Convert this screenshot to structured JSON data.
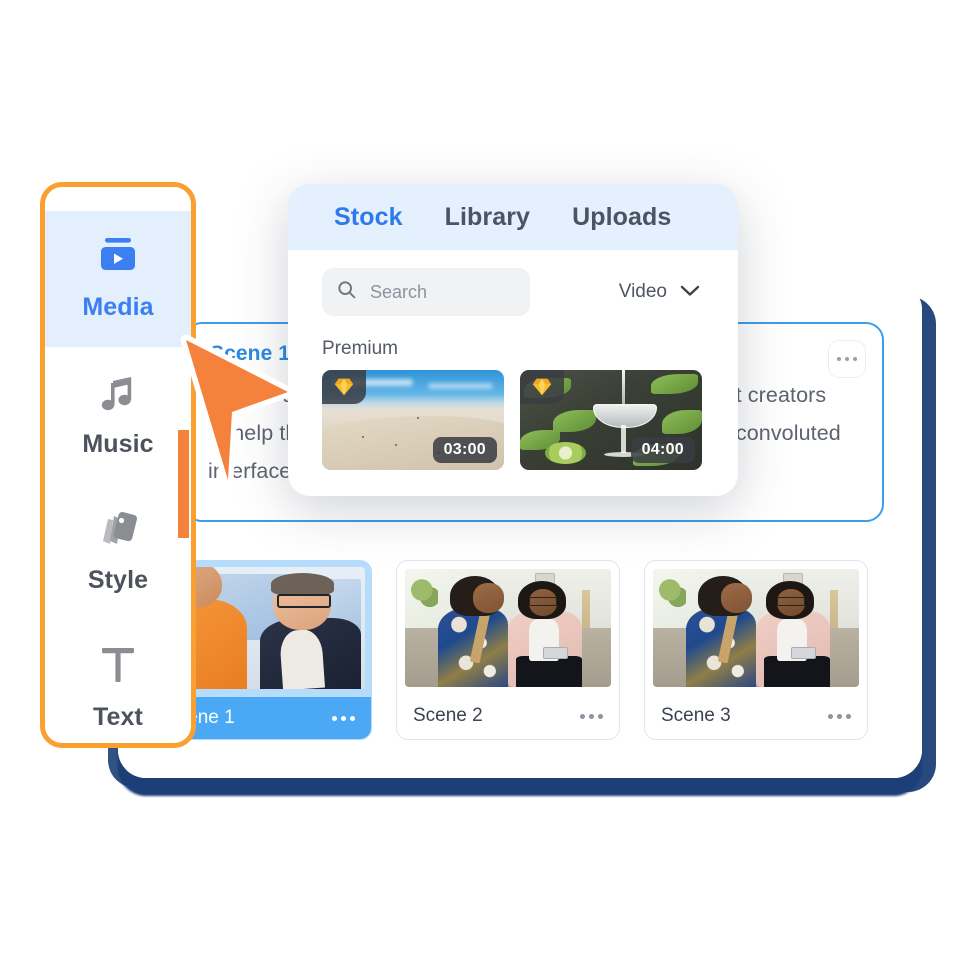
{
  "sidebar": {
    "items": [
      {
        "label": "Media",
        "icon": "media-video-icon",
        "active": true
      },
      {
        "label": "Music",
        "icon": "music-note-icon",
        "active": false
      },
      {
        "label": "Style",
        "icon": "style-cards-icon",
        "active": false
      },
      {
        "label": "Text",
        "icon": "text-t-icon",
        "active": false
      }
    ]
  },
  "popup": {
    "tabs": [
      {
        "label": "Stock",
        "active": true
      },
      {
        "label": "Library",
        "active": false
      },
      {
        "label": "Uploads",
        "active": false
      }
    ],
    "search": {
      "placeholder": "Search",
      "value": "",
      "icon": "search-icon"
    },
    "filter": {
      "value": "Video",
      "icon": "chevron-down-icon"
    },
    "section_title": "Premium",
    "thumbnails": [
      {
        "duration": "03:00",
        "badge": "premium-gem-icon",
        "alt": "desert-dunes-video"
      },
      {
        "duration": "04:00",
        "badge": "premium-gem-icon",
        "alt": "cocktail-pour-video"
      }
    ]
  },
  "script_card": {
    "title": "Scene 1",
    "body": "Visia is a platform built for digital marketers and content creators to help them create videos quickly without learning the convoluted interfaces of other editing softwares.",
    "menu_icon": "more-options-icon"
  },
  "scenes": [
    {
      "label": "Scene 1",
      "selected": true,
      "menu_icon": "more-options-icon"
    },
    {
      "label": "Scene 2",
      "selected": false,
      "menu_icon": "more-options-icon"
    },
    {
      "label": "Scene 3",
      "selected": false,
      "menu_icon": "more-options-icon"
    }
  ],
  "colors": {
    "accent_blue": "#3b7ff0",
    "tab_bar_bg": "#e4f0fd",
    "highlight_orange": "#f9a031",
    "cursor_orange": "#f4813c",
    "selected_scene_blue": "#4aa8f5",
    "card_shadow_navy": "#1c3f77",
    "script_border_blue": "#3d9ceb"
  }
}
